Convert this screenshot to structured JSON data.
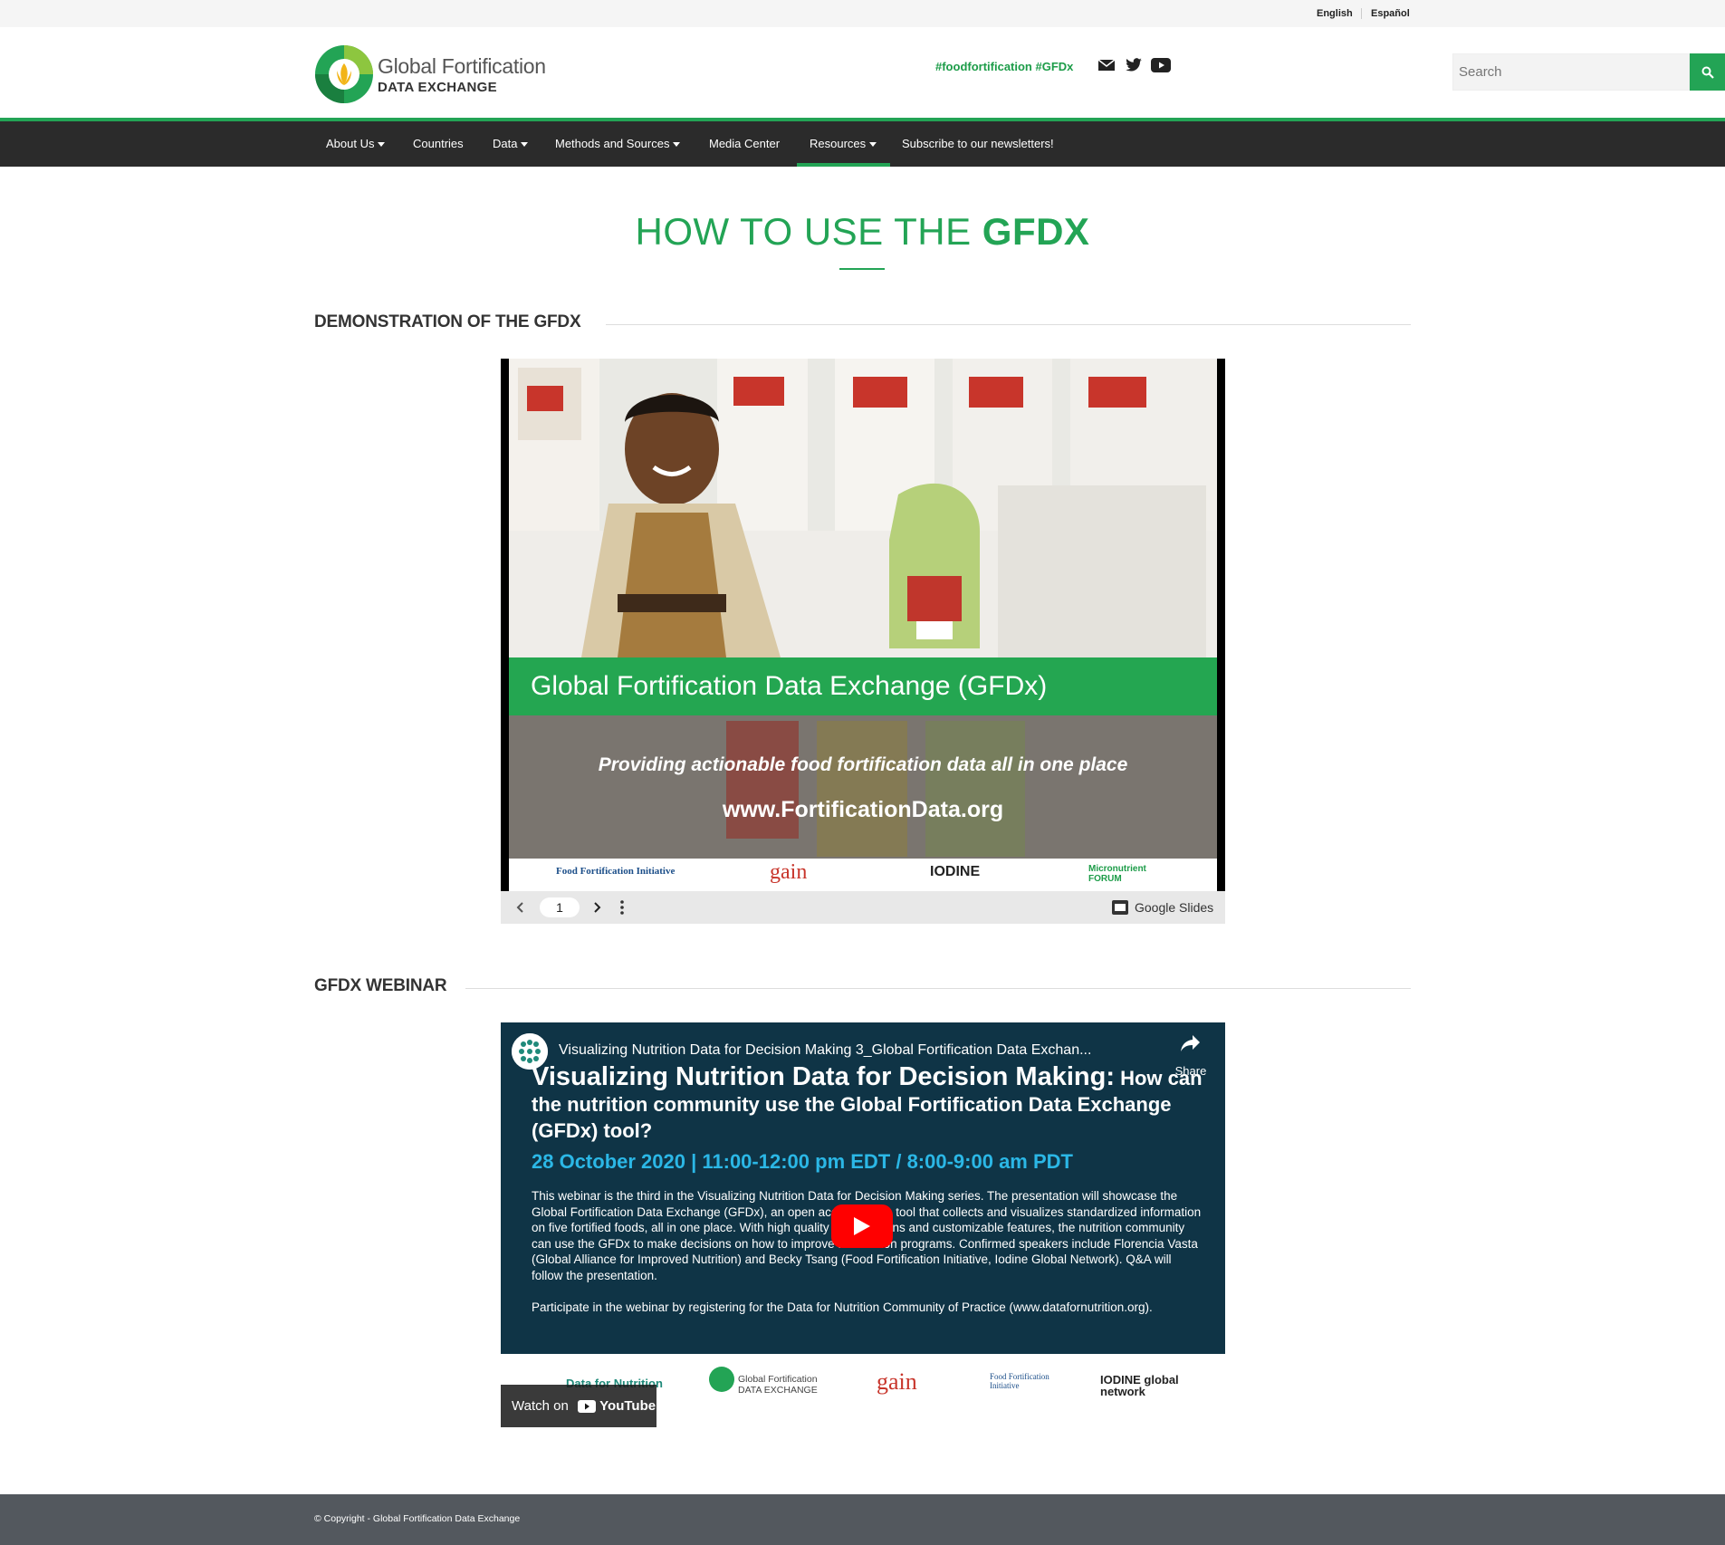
{
  "language": {
    "english": "English",
    "spanish": "Español"
  },
  "header": {
    "logo_line1": "Global Fortification",
    "logo_line2": "DATA EXCHANGE",
    "hashtags": "#foodfortification #GFDx",
    "search_placeholder": "Search",
    "social_icons": [
      "mail-icon",
      "twitter-icon",
      "youtube-icon"
    ]
  },
  "nav": {
    "items": [
      {
        "label": "About Us",
        "dropdown": true
      },
      {
        "label": "Countries",
        "dropdown": false
      },
      {
        "label": "Data",
        "dropdown": true
      },
      {
        "label": "Methods and Sources",
        "dropdown": true
      },
      {
        "label": "Media Center",
        "dropdown": false
      },
      {
        "label": "Resources",
        "dropdown": true,
        "active": true
      },
      {
        "label": "Subscribe to our newsletters!",
        "dropdown": false
      }
    ]
  },
  "page": {
    "title_light": "HOW TO USE THE ",
    "title_bold": "GFDX"
  },
  "demo": {
    "heading": "DEMONSTRATION OF THE GFDX",
    "slide_banner": "Global Fortification Data Exchange (GFDx)",
    "slide_tagline": "Providing actionable food fortification data all in one place",
    "slide_url": "www.FortificationData.org",
    "slide_logos": [
      "Food Fortification Initiative",
      "gain",
      "IODINE",
      "Micronutrient FORUM"
    ],
    "current_page": "1",
    "viewer_label": "Google Slides"
  },
  "webinar": {
    "heading": "GFDX WEBINAR",
    "video_title": "Visualizing Nutrition Data for Decision Making 3_Global Fortification Data Exchan...",
    "share_label": "Share",
    "headline_big": "Visualizing Nutrition Data for Decision Making:",
    "headline_rest": " How can the nutrition community use the Global Fortification Data Exchange (GFDx) tool?",
    "date_line": "28 October 2020 | 11:00-12:00 pm EDT / 8:00-9:00 am PDT",
    "paragraph1": "This webinar is the third in the Visualizing Nutrition Data for Decision Making series. The presentation will showcase the Global Fortification Data Exchange (GFDx), an open access online tool that collects and visualizes standardized information on five fortified foods, all in one place. With high quality visualizations and customizable features, the nutrition community can use the GFDx to make decisions on how to improve fortification programs. Confirmed speakers include Florencia Vasta (Global Alliance for Improved Nutrition) and Becky Tsang (Food Fortification Initiative, Iodine Global Network). Q&A will follow the presentation.",
    "paragraph2": "Participate in the webinar by registering for the Data for Nutrition Community of Practice (www.datafornutrition.org).",
    "watch_label": "Watch on",
    "youtube_label": "YouTube",
    "partner_logos": [
      "Data for Nutrition",
      "Global Fortification DATA EXCHANGE",
      "gain",
      "Food Fortification Initiative",
      "IODINE global network"
    ]
  },
  "footer": {
    "copyright": "© Copyright - Global Fortification Data Exchange"
  },
  "colors": {
    "brand_green": "#23a455",
    "nav_bg": "#2b2b2b",
    "footer_bg": "#53585e",
    "webinar_bg": "#0f3446",
    "date_blue": "#2bb7e6"
  }
}
